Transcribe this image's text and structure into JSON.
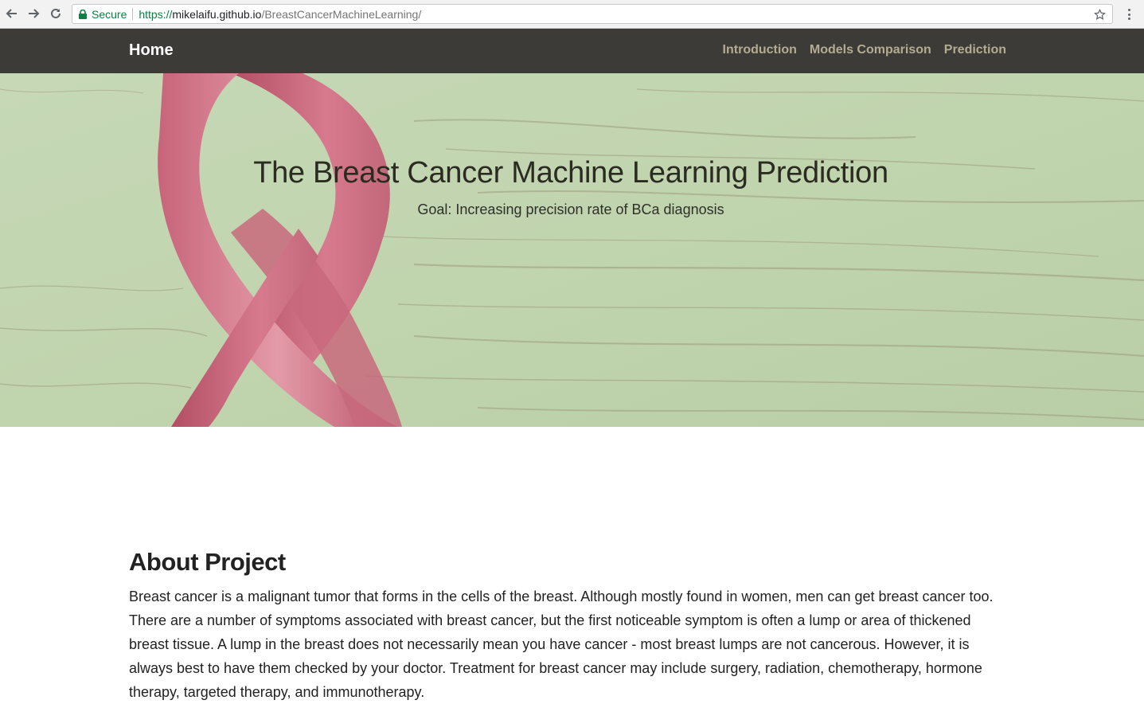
{
  "browser": {
    "secure_label": "Secure",
    "url_scheme": "https://",
    "url_host": "mikelaifu.github.io",
    "url_path": "/BreastCancerMachineLearning/",
    "icons": [
      "back-arrow-icon",
      "forward-arrow-icon",
      "reload-icon",
      "lock-icon",
      "star-icon",
      "menu-dots-icon"
    ]
  },
  "navbar": {
    "brand": "Home",
    "links": [
      "Introduction",
      "Models Comparison",
      "Prediction"
    ]
  },
  "hero": {
    "title": "The Breast Cancer Machine Learning Prediction",
    "subtitle": "Goal: Increasing precision rate of BCa diagnosis"
  },
  "about": {
    "heading": "About Project",
    "body": "Breast cancer is a malignant tumor that forms in the cells of the breast. Although mostly found in women, men can get breast cancer too. There are a number of symptoms associated with breast cancer, but the first noticeable symptom is often a lump or area of thickened breast tissue. A lump in the breast does not necessarily mean you have cancer - most breast lumps are not cancerous. However, it is always best to have them checked by your doctor. Treatment for breast cancer may include surgery, radiation, chemotherapy, hormone therapy, targeted therapy, and immunotherapy."
  },
  "colors": {
    "navbar_bg": "#3c3b37",
    "nav_link": "#b3ac92",
    "ribbon": "#d77a8e",
    "wood": "#c3d6b3"
  }
}
